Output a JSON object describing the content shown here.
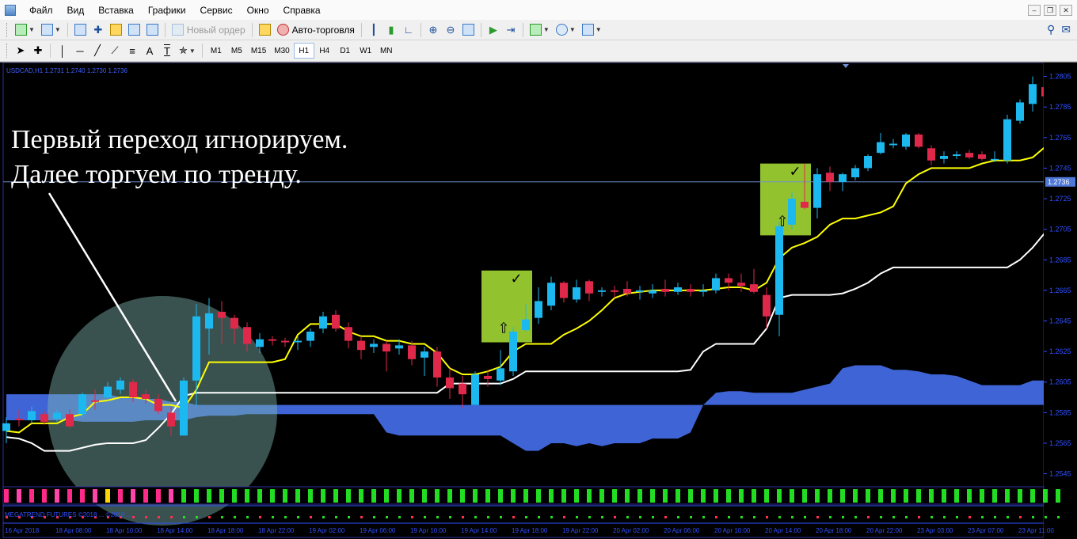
{
  "menu": {
    "items": [
      "Файл",
      "Вид",
      "Вставка",
      "Графики",
      "Сервис",
      "Окно",
      "Справка"
    ]
  },
  "toolbar": {
    "new_order_label": "Новый ордер",
    "auto_trading_label": "Авто-торговля",
    "drawing_tools": {
      "text_tool": "A",
      "label_tool": "T"
    }
  },
  "timeframes": {
    "items": [
      "M1",
      "M5",
      "M15",
      "M30",
      "H1",
      "H4",
      "D1",
      "W1",
      "MN"
    ],
    "active": "H1"
  },
  "chart": {
    "symbol_info": "USDCAD,H1  1.2731 1.2740 1.2730 1.2736",
    "annotation_line1": "Первый переход игнорируем.",
    "annotation_line2": "Далее торгуем по тренду.",
    "current_price_label": "1.2736",
    "indicator_label": "MEGATREND FUTURES  ©2018 ...  ©2018 ...",
    "colors": {
      "bull": "#1cb8f0",
      "bear": "#e0284a",
      "fast_line": "#ffff00",
      "slow_line": "#ffffff",
      "cloud": "#4169e1",
      "signal_box": "#9acd32",
      "highlight_circle": "#7fb5b0"
    }
  },
  "chart_data": {
    "type": "candlestick",
    "symbol": "USDCAD",
    "timeframe": "H1",
    "price_ticks": [
      "1.2805",
      "1.2785",
      "1.2765",
      "1.2745",
      "1.2725",
      "1.2705",
      "1.2685",
      "1.2665",
      "1.2645",
      "1.2625",
      "1.2605",
      "1.2585",
      "1.2565",
      "1.2545"
    ],
    "time_ticks": [
      "16 Apr 2018",
      "18 Apr 08:00",
      "18 Apr 10:00",
      "18 Apr 14:00",
      "18 Apr 18:00",
      "18 Apr 22:00",
      "19 Apr 02:00",
      "19 Apr 06:00",
      "19 Apr 10:00",
      "19 Apr 14:00",
      "19 Apr 18:00",
      "19 Apr 22:00",
      "20 Apr 02:00",
      "20 Apr 06:00",
      "20 Apr 10:00",
      "20 Apr 14:00",
      "20 Apr 18:00",
      "20 Apr 22:00",
      "23 Apr 03:00",
      "23 Apr 07:00",
      "23 Apr 11:00"
    ],
    "ylim": [
      1.2537,
      1.2811
    ],
    "candles": [
      {
        "o": 1.2573,
        "h": 1.2582,
        "l": 1.2565,
        "c": 1.2578
      },
      {
        "o": 1.2581,
        "h": 1.2587,
        "l": 1.2576,
        "c": 1.258
      },
      {
        "o": 1.258,
        "h": 1.2589,
        "l": 1.2578,
        "c": 1.2586
      },
      {
        "o": 1.2584,
        "h": 1.2586,
        "l": 1.2577,
        "c": 1.2579
      },
      {
        "o": 1.2581,
        "h": 1.2587,
        "l": 1.2579,
        "c": 1.2585
      },
      {
        "o": 1.2584,
        "h": 1.2587,
        "l": 1.2575,
        "c": 1.2576
      },
      {
        "o": 1.2584,
        "h": 1.2598,
        "l": 1.2582,
        "c": 1.2597
      },
      {
        "o": 1.2593,
        "h": 1.26,
        "l": 1.2587,
        "c": 1.2592
      },
      {
        "o": 1.2595,
        "h": 1.2605,
        "l": 1.2593,
        "c": 1.2602
      },
      {
        "o": 1.26,
        "h": 1.2608,
        "l": 1.2597,
        "c": 1.2606
      },
      {
        "o": 1.2605,
        "h": 1.2607,
        "l": 1.2592,
        "c": 1.2595
      },
      {
        "o": 1.2597,
        "h": 1.26,
        "l": 1.2591,
        "c": 1.2594
      },
      {
        "o": 1.2594,
        "h": 1.2597,
        "l": 1.2584,
        "c": 1.2586
      },
      {
        "o": 1.2585,
        "h": 1.2589,
        "l": 1.257,
        "c": 1.2576
      },
      {
        "o": 1.257,
        "h": 1.2608,
        "l": 1.257,
        "c": 1.2606
      },
      {
        "o": 1.2606,
        "h": 1.2656,
        "l": 1.2589,
        "c": 1.2648
      },
      {
        "o": 1.264,
        "h": 1.266,
        "l": 1.2623,
        "c": 1.265
      },
      {
        "o": 1.2651,
        "h": 1.2658,
        "l": 1.263,
        "c": 1.2647
      },
      {
        "o": 1.2647,
        "h": 1.2649,
        "l": 1.263,
        "c": 1.264
      },
      {
        "o": 1.2641,
        "h": 1.2644,
        "l": 1.2625,
        "c": 1.263
      },
      {
        "o": 1.2628,
        "h": 1.2637,
        "l": 1.2624,
        "c": 1.2633
      },
      {
        "o": 1.2633,
        "h": 1.2635,
        "l": 1.2629,
        "c": 1.2632
      },
      {
        "o": 1.2632,
        "h": 1.2634,
        "l": 1.2628,
        "c": 1.2631
      },
      {
        "o": 1.2631,
        "h": 1.2635,
        "l": 1.2626,
        "c": 1.2632
      },
      {
        "o": 1.2632,
        "h": 1.264,
        "l": 1.2628,
        "c": 1.2638
      },
      {
        "o": 1.264,
        "h": 1.2651,
        "l": 1.2637,
        "c": 1.2648
      },
      {
        "o": 1.2649,
        "h": 1.2652,
        "l": 1.2638,
        "c": 1.264
      },
      {
        "o": 1.2641,
        "h": 1.2644,
        "l": 1.2627,
        "c": 1.2632
      },
      {
        "o": 1.2632,
        "h": 1.2635,
        "l": 1.262,
        "c": 1.2626
      },
      {
        "o": 1.2628,
        "h": 1.2633,
        "l": 1.2624,
        "c": 1.263
      },
      {
        "o": 1.263,
        "h": 1.2632,
        "l": 1.2612,
        "c": 1.2625
      },
      {
        "o": 1.2627,
        "h": 1.2633,
        "l": 1.2623,
        "c": 1.2629
      },
      {
        "o": 1.2629,
        "h": 1.2632,
        "l": 1.2616,
        "c": 1.262
      },
      {
        "o": 1.2621,
        "h": 1.2628,
        "l": 1.2609,
        "c": 1.2625
      },
      {
        "o": 1.2625,
        "h": 1.2628,
        "l": 1.2602,
        "c": 1.2608
      },
      {
        "o": 1.2608,
        "h": 1.2614,
        "l": 1.2594,
        "c": 1.2601
      },
      {
        "o": 1.2604,
        "h": 1.2609,
        "l": 1.2588,
        "c": 1.2597
      },
      {
        "o": 1.259,
        "h": 1.2612,
        "l": 1.259,
        "c": 1.261
      },
      {
        "o": 1.2609,
        "h": 1.2613,
        "l": 1.2602,
        "c": 1.2607
      },
      {
        "o": 1.2606,
        "h": 1.2626,
        "l": 1.2603,
        "c": 1.2614
      },
      {
        "o": 1.2612,
        "h": 1.2641,
        "l": 1.2609,
        "c": 1.2638
      },
      {
        "o": 1.2639,
        "h": 1.2656,
        "l": 1.2638,
        "c": 1.2646
      },
      {
        "o": 1.2647,
        "h": 1.2667,
        "l": 1.2643,
        "c": 1.2658
      },
      {
        "o": 1.2655,
        "h": 1.2674,
        "l": 1.2652,
        "c": 1.267
      },
      {
        "o": 1.267,
        "h": 1.2671,
        "l": 1.2657,
        "c": 1.266
      },
      {
        "o": 1.2659,
        "h": 1.2672,
        "l": 1.2657,
        "c": 1.2667
      },
      {
        "o": 1.2671,
        "h": 1.2672,
        "l": 1.2658,
        "c": 1.2663
      },
      {
        "o": 1.2664,
        "h": 1.2667,
        "l": 1.2661,
        "c": 1.2665
      },
      {
        "o": 1.2665,
        "h": 1.2668,
        "l": 1.266,
        "c": 1.2664
      },
      {
        "o": 1.2666,
        "h": 1.2671,
        "l": 1.2661,
        "c": 1.2663
      },
      {
        "o": 1.2664,
        "h": 1.2668,
        "l": 1.2659,
        "c": 1.2665
      },
      {
        "o": 1.2663,
        "h": 1.2669,
        "l": 1.266,
        "c": 1.2665
      },
      {
        "o": 1.2666,
        "h": 1.2672,
        "l": 1.2661,
        "c": 1.2664
      },
      {
        "o": 1.2664,
        "h": 1.267,
        "l": 1.2662,
        "c": 1.2667
      },
      {
        "o": 1.2666,
        "h": 1.2669,
        "l": 1.2661,
        "c": 1.2664
      },
      {
        "o": 1.2664,
        "h": 1.2669,
        "l": 1.2661,
        "c": 1.2665
      },
      {
        "o": 1.2665,
        "h": 1.2676,
        "l": 1.2663,
        "c": 1.2673
      },
      {
        "o": 1.2673,
        "h": 1.2676,
        "l": 1.2665,
        "c": 1.267
      },
      {
        "o": 1.267,
        "h": 1.2676,
        "l": 1.2664,
        "c": 1.2668
      },
      {
        "o": 1.2669,
        "h": 1.2679,
        "l": 1.2663,
        "c": 1.2664
      },
      {
        "o": 1.2662,
        "h": 1.2667,
        "l": 1.264,
        "c": 1.2648
      },
      {
        "o": 1.2649,
        "h": 1.271,
        "l": 1.2635,
        "c": 1.2707
      },
      {
        "o": 1.2708,
        "h": 1.2729,
        "l": 1.2705,
        "c": 1.2725
      },
      {
        "o": 1.2723,
        "h": 1.2748,
        "l": 1.2718,
        "c": 1.2719
      },
      {
        "o": 1.2719,
        "h": 1.2745,
        "l": 1.2712,
        "c": 1.2741
      },
      {
        "o": 1.2742,
        "h": 1.2746,
        "l": 1.273,
        "c": 1.2736
      },
      {
        "o": 1.2736,
        "h": 1.2742,
        "l": 1.273,
        "c": 1.2741
      },
      {
        "o": 1.2739,
        "h": 1.2747,
        "l": 1.2737,
        "c": 1.2745
      },
      {
        "o": 1.2745,
        "h": 1.2754,
        "l": 1.2743,
        "c": 1.2753
      },
      {
        "o": 1.2755,
        "h": 1.2768,
        "l": 1.2754,
        "c": 1.2762
      },
      {
        "o": 1.276,
        "h": 1.2764,
        "l": 1.2758,
        "c": 1.2761
      },
      {
        "o": 1.2759,
        "h": 1.2768,
        "l": 1.2757,
        "c": 1.2767
      },
      {
        "o": 1.2767,
        "h": 1.2768,
        "l": 1.2758,
        "c": 1.2759
      },
      {
        "o": 1.2758,
        "h": 1.276,
        "l": 1.2747,
        "c": 1.275
      },
      {
        "o": 1.2751,
        "h": 1.2756,
        "l": 1.2748,
        "c": 1.2753
      },
      {
        "o": 1.2753,
        "h": 1.2756,
        "l": 1.2751,
        "c": 1.2754
      },
      {
        "o": 1.2755,
        "h": 1.2757,
        "l": 1.2751,
        "c": 1.2752
      },
      {
        "o": 1.2754,
        "h": 1.2756,
        "l": 1.275,
        "c": 1.2751
      },
      {
        "o": 1.2751,
        "h": 1.2756,
        "l": 1.2749,
        "c": 1.2751
      },
      {
        "o": 1.275,
        "h": 1.278,
        "l": 1.2748,
        "c": 1.2777
      },
      {
        "o": 1.2776,
        "h": 1.279,
        "l": 1.2774,
        "c": 1.2788
      },
      {
        "o": 1.2787,
        "h": 1.2805,
        "l": 1.2782,
        "c": 1.28
      },
      {
        "o": 1.2798,
        "h": 1.2801,
        "l": 1.2786,
        "c": 1.2792
      },
      {
        "o": 1.2793,
        "h": 1.2797,
        "l": 1.2774,
        "c": 1.2777
      }
    ],
    "fast_line": [
      1.2573,
      1.2572,
      1.2578,
      1.2578,
      1.2578,
      1.2582,
      1.2584,
      1.2592,
      1.2593,
      1.2595,
      1.2595,
      1.2594,
      1.259,
      1.259,
      1.2588,
      1.26,
      1.2618,
      1.2618,
      1.2618,
      1.2618,
      1.2618,
      1.2618,
      1.262,
      1.2636,
      1.2643,
      1.2643,
      1.2643,
      1.2638,
      1.2635,
      1.2635,
      1.2632,
      1.2632,
      1.263,
      1.263,
      1.2624,
      1.2614,
      1.261,
      1.261,
      1.2612,
      1.2615,
      1.2625,
      1.263,
      1.263,
      1.263,
      1.2636,
      1.264,
      1.2645,
      1.2652,
      1.266,
      1.2663,
      1.2664,
      1.2665,
      1.2665,
      1.2665,
      1.2665,
      1.2665,
      1.2666,
      1.2667,
      1.2667,
      1.2665,
      1.267,
      1.2686,
      1.2693,
      1.2696,
      1.27,
      1.2708,
      1.2712,
      1.2712,
      1.2714,
      1.2716,
      1.272,
      1.2735,
      1.2741,
      1.2745,
      1.2745,
      1.2745,
      1.2745,
      1.2748,
      1.275,
      1.275,
      1.275,
      1.2752,
      1.2759,
      1.2767,
      1.277,
      1.277
    ],
    "slow_line": [
      1.2569,
      1.2568,
      1.2565,
      1.256,
      1.256,
      1.256,
      1.2562,
      1.2564,
      1.2565,
      1.2565,
      1.2565,
      1.2567,
      1.2575,
      1.2584,
      1.2596,
      1.2598,
      1.2598,
      1.2598,
      1.2598,
      1.2598,
      1.2598,
      1.2598,
      1.2598,
      1.2598,
      1.2598,
      1.2598,
      1.2598,
      1.2598,
      1.2598,
      1.2598,
      1.2598,
      1.2598,
      1.2598,
      1.2598,
      1.2598,
      1.2604,
      1.2604,
      1.2604,
      1.2604,
      1.2604,
      1.2607,
      1.2612,
      1.2612,
      1.2612,
      1.2612,
      1.2612,
      1.2612,
      1.2612,
      1.2612,
      1.2612,
      1.2612,
      1.2612,
      1.2612,
      1.2612,
      1.2613,
      1.2625,
      1.263,
      1.263,
      1.263,
      1.263,
      1.264,
      1.266,
      1.2662,
      1.2662,
      1.2662,
      1.2662,
      1.2663,
      1.2666,
      1.267,
      1.2676,
      1.268,
      1.268,
      1.268,
      1.268,
      1.268,
      1.268,
      1.268,
      1.268,
      1.268,
      1.268,
      1.2685,
      1.2693,
      1.2703,
      1.2708,
      1.271,
      1.271
    ],
    "cloud_top": [
      1.2597,
      1.2597,
      1.2597,
      1.2597,
      1.2597,
      1.2597,
      1.2597,
      1.2597,
      1.2597,
      1.2595,
      1.2595,
      1.2594,
      1.2594,
      1.2592,
      1.2592,
      1.259,
      1.259,
      1.259,
      1.259,
      1.259,
      1.259,
      1.259,
      1.259,
      1.259,
      1.259,
      1.259,
      1.259,
      1.259,
      1.259,
      1.259,
      1.259,
      1.259,
      1.259,
      1.259,
      1.259,
      1.259,
      1.259,
      1.259,
      1.259,
      1.259,
      1.259,
      1.259,
      1.259,
      1.259,
      1.259,
      1.259,
      1.259,
      1.259,
      1.259,
      1.259,
      1.259,
      1.259,
      1.259,
      1.259,
      1.259,
      1.259,
      1.259,
      1.259,
      1.259,
      1.259,
      1.259,
      1.259,
      1.259,
      1.259,
      1.259,
      1.259,
      1.259,
      1.259,
      1.259,
      1.259,
      1.259,
      1.259,
      1.259,
      1.259,
      1.259,
      1.259,
      1.259,
      1.259,
      1.259,
      1.259,
      1.259,
      1.259,
      1.259,
      1.259,
      1.259,
      1.259
    ],
    "cloud_bottom": [
      1.258,
      1.258,
      1.258,
      1.258,
      1.258,
      1.258,
      1.2579,
      1.2579,
      1.2579,
      1.2579,
      1.2579,
      1.258,
      1.258,
      1.258,
      1.258,
      1.2582,
      1.2583,
      1.2583,
      1.2583,
      1.2584,
      1.2584,
      1.2584,
      1.2584,
      1.2584,
      1.2584,
      1.2584,
      1.2584,
      1.2584,
      1.2584,
      1.2584,
      1.2572,
      1.257,
      1.257,
      1.257,
      1.257,
      1.257,
      1.257,
      1.257,
      1.257,
      1.257,
      1.2565,
      1.256,
      1.256,
      1.2565,
      1.2565,
      1.2563,
      1.2565,
      1.2563,
      1.2565,
      1.2565,
      1.2565,
      1.2568,
      1.2568,
      1.2568,
      1.2572,
      1.259,
      1.2598,
      1.2599,
      1.2599,
      1.2598,
      1.2598,
      1.2598,
      1.2598,
      1.26,
      1.2602,
      1.2604,
      1.2614,
      1.2616,
      1.2616,
      1.2616,
      1.2613,
      1.2613,
      1.2612,
      1.261,
      1.261,
      1.2609,
      1.2606,
      1.2603,
      1.2603,
      1.2603,
      1.2603,
      1.2606,
      1.2606,
      1.2609,
      1.2612,
      1.2612
    ],
    "signal_boxes": [
      {
        "from": 38,
        "to": 41,
        "hi": 1.2678,
        "lo": 1.2631
      },
      {
        "from": 60,
        "to": 63,
        "hi": 1.2748,
        "lo": 1.2701
      }
    ],
    "current_price": 1.2736
  }
}
